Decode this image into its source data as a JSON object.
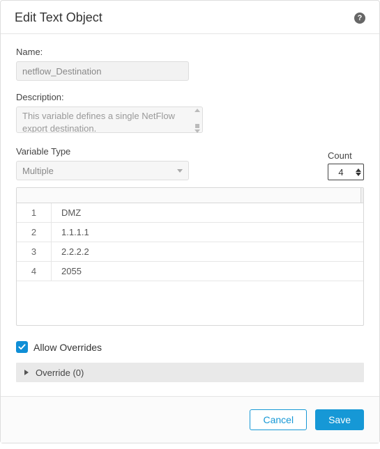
{
  "header": {
    "title": "Edit Text Object",
    "help_icon": "?"
  },
  "fields": {
    "name_label": "Name:",
    "name_value": "netflow_Destination",
    "description_label": "Description:",
    "description_value": "This variable defines a single NetFlow export destination.",
    "variable_type_label": "Variable Type",
    "variable_type_value": "Multiple",
    "count_label": "Count",
    "count_value": "4"
  },
  "table": {
    "rows": [
      {
        "index": "1",
        "value": "DMZ"
      },
      {
        "index": "2",
        "value": "1.1.1.1"
      },
      {
        "index": "3",
        "value": "2.2.2.2"
      },
      {
        "index": "4",
        "value": "2055"
      }
    ]
  },
  "overrides": {
    "checkbox_label": "Allow Overrides",
    "checkbox_checked": true,
    "accordion_label": "Override (0)"
  },
  "footer": {
    "cancel": "Cancel",
    "save": "Save"
  }
}
